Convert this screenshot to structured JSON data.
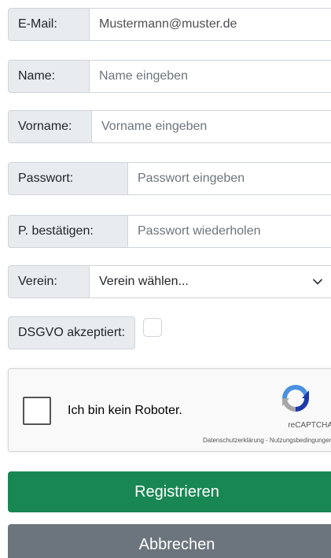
{
  "form": {
    "email": {
      "label": "E-Mail:",
      "value": "Mustermann@muster.de"
    },
    "name": {
      "label": "Name:",
      "placeholder": "Name eingeben"
    },
    "vorname": {
      "label": "Vorname:",
      "placeholder": "Vorname eingeben"
    },
    "passwort": {
      "label": "Passwort:",
      "placeholder": "Passwort eingeben"
    },
    "bestaetigen": {
      "label": "P. bestätigen:",
      "placeholder": "Passwort wiederholen"
    },
    "verein": {
      "label": "Verein:",
      "selected": "Verein wählen..."
    },
    "dsgvo": {
      "label": "DSGVO akzeptiert:",
      "checked": false
    }
  },
  "captcha": {
    "label": "Ich bin kein Roboter.",
    "brand": "reCAPTCHA",
    "terms": "Datenschutzerklärung - Nutzungsbedingungen",
    "icon": "recaptcha-logo-icon"
  },
  "buttons": {
    "register": "Registrieren",
    "cancel": "Abbrechen"
  },
  "colors": {
    "primary": "#198754",
    "secondary": "#6c757d",
    "addon_bg": "#e9ecef",
    "border": "#ced4da"
  }
}
